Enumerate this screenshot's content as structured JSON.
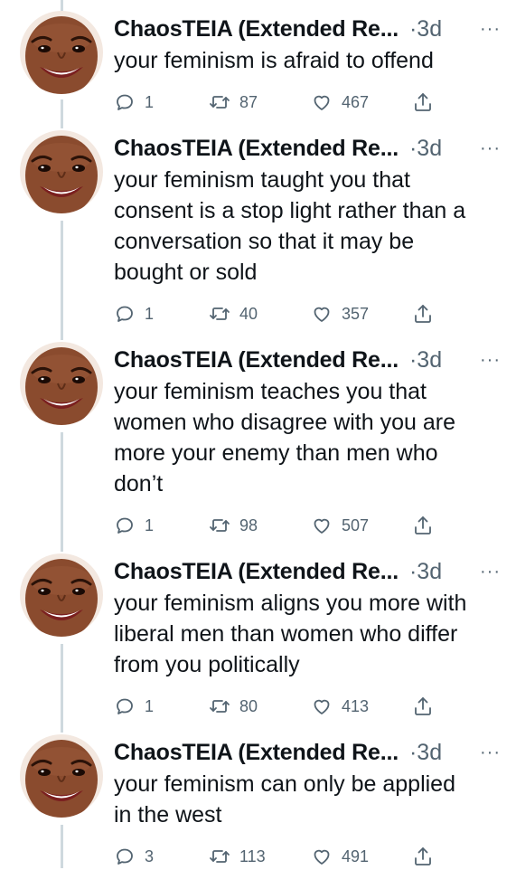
{
  "tweets": [
    {
      "name": "ChaosTEIA (Extended Re...",
      "time": "·3d",
      "more": "···",
      "text": "your feminism is afraid to offend",
      "replies": "1",
      "retweets": "87",
      "likes": "467"
    },
    {
      "name": "ChaosTEIA (Extended Re...",
      "time": "·3d",
      "more": "···",
      "text": "your feminism taught you that\nconsent is a stop light rather than a\nconversation so that it may be\nbought or sold",
      "replies": "1",
      "retweets": "40",
      "likes": "357"
    },
    {
      "name": "ChaosTEIA (Extended Re...",
      "time": "·3d",
      "more": "···",
      "text": "your feminism teaches you that\nwomen who disagree with you are\nmore your enemy than men who\ndon’t",
      "replies": "1",
      "retweets": "98",
      "likes": "507"
    },
    {
      "name": "ChaosTEIA (Extended Re...",
      "time": "·3d",
      "more": "···",
      "text": "your feminism aligns you more with\nliberal men than women who differ\nfrom you politically",
      "replies": "1",
      "retweets": "80",
      "likes": "413"
    },
    {
      "name": "ChaosTEIA (Extended Re...",
      "time": "·3d",
      "more": "···",
      "text": "your feminism can only be applied\nin the west",
      "replies": "3",
      "retweets": "113",
      "likes": "491"
    }
  ],
  "icons": {
    "reply": "reply-icon",
    "retweet": "retweet-icon",
    "like": "heart-icon",
    "share": "share-icon",
    "more": "more-icon"
  },
  "colors": {
    "text": "#0f1419",
    "muted": "#536471",
    "line": "#cfd9de",
    "skin": "#8a4b2e",
    "bg": "#ffffff"
  }
}
